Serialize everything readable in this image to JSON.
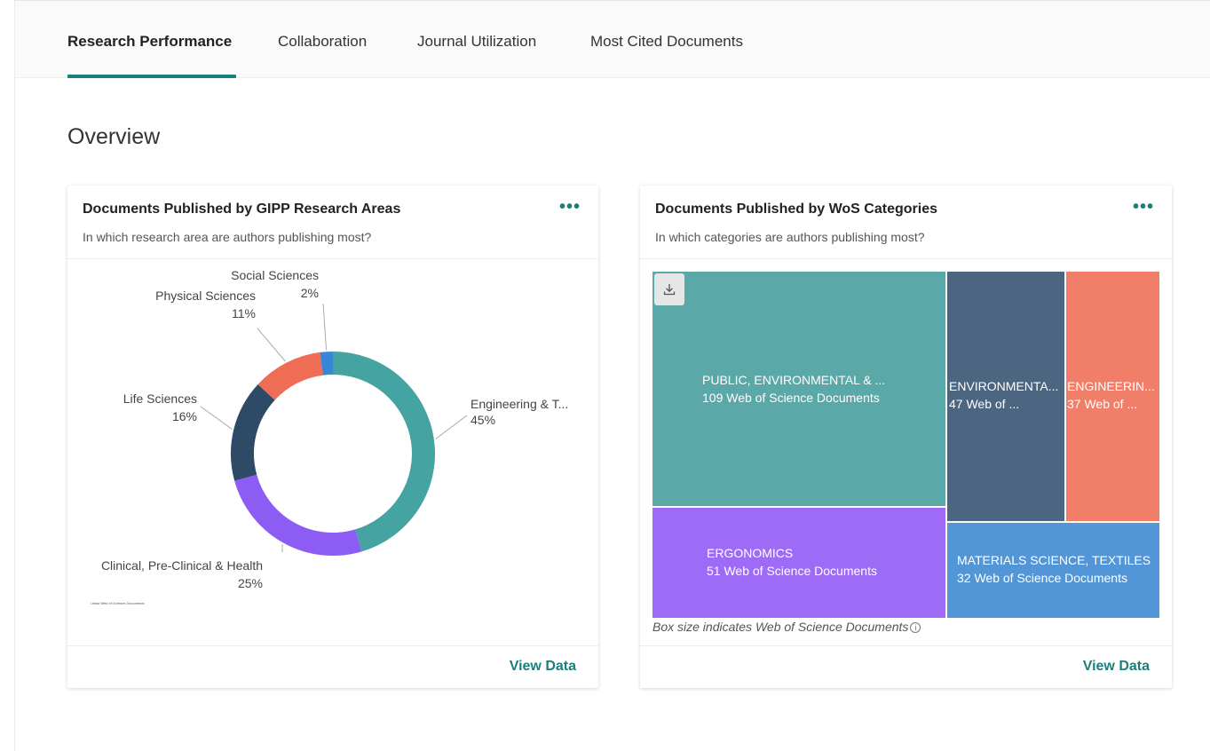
{
  "tabs": [
    {
      "label": "Research Performance",
      "active": true
    },
    {
      "label": "Collaboration",
      "active": false
    },
    {
      "label": "Journal Utilization",
      "active": false
    },
    {
      "label": "Most Cited Documents",
      "active": false
    }
  ],
  "overview_title": "Overview",
  "accent_color": "#1a7f7a",
  "card_areas": {
    "title": "Documents Published by GIPP Research Areas",
    "subtitle": "In which research area are authors publishing most?",
    "more_label": "•••",
    "view_data_label": "View Data",
    "footnote": "Unital Web of Science Documents"
  },
  "card_categories": {
    "title": "Documents Published by WoS Categories",
    "subtitle": "In which categories are authors publishing most?",
    "more_label": "•••",
    "view_data_label": "View Data",
    "note": "Box size indicates Web of Science Documents",
    "info_glyph": "i"
  },
  "chart_data": [
    {
      "type": "pie",
      "variant": "donut",
      "categories": [
        "Engineering & T...",
        "Clinical, Pre-Clinical & Health",
        "Life Sciences",
        "Physical Sciences",
        "Social Sciences"
      ],
      "values": [
        45,
        25,
        16,
        11,
        2
      ],
      "value_labels": [
        "45%",
        "25%",
        "16%",
        "11%",
        "2%"
      ],
      "colors": [
        "#45a3a2",
        "#8c5cf5",
        "#2d4a66",
        "#ef6c55",
        "#3a86d6"
      ]
    },
    {
      "type": "treemap",
      "categories": [
        "PUBLIC, ENVIRONMENTAL & ...",
        "ERGONOMICS",
        "ENVIRONMENTA...",
        "ENGINEERIN...",
        "MATERIALS SCIENCE, TEXTILES"
      ],
      "values": [
        109,
        51,
        47,
        37,
        32
      ],
      "value_labels": [
        "109 Web of Science Documents",
        "51 Web of Science Documents",
        "47 Web of ...",
        "37 Web of ...",
        "32 Web of Science Documents"
      ],
      "colors": [
        "#5aa8a8",
        "#9e6bf7",
        "#4c6580",
        "#f07e68",
        "#5296d8"
      ]
    }
  ]
}
